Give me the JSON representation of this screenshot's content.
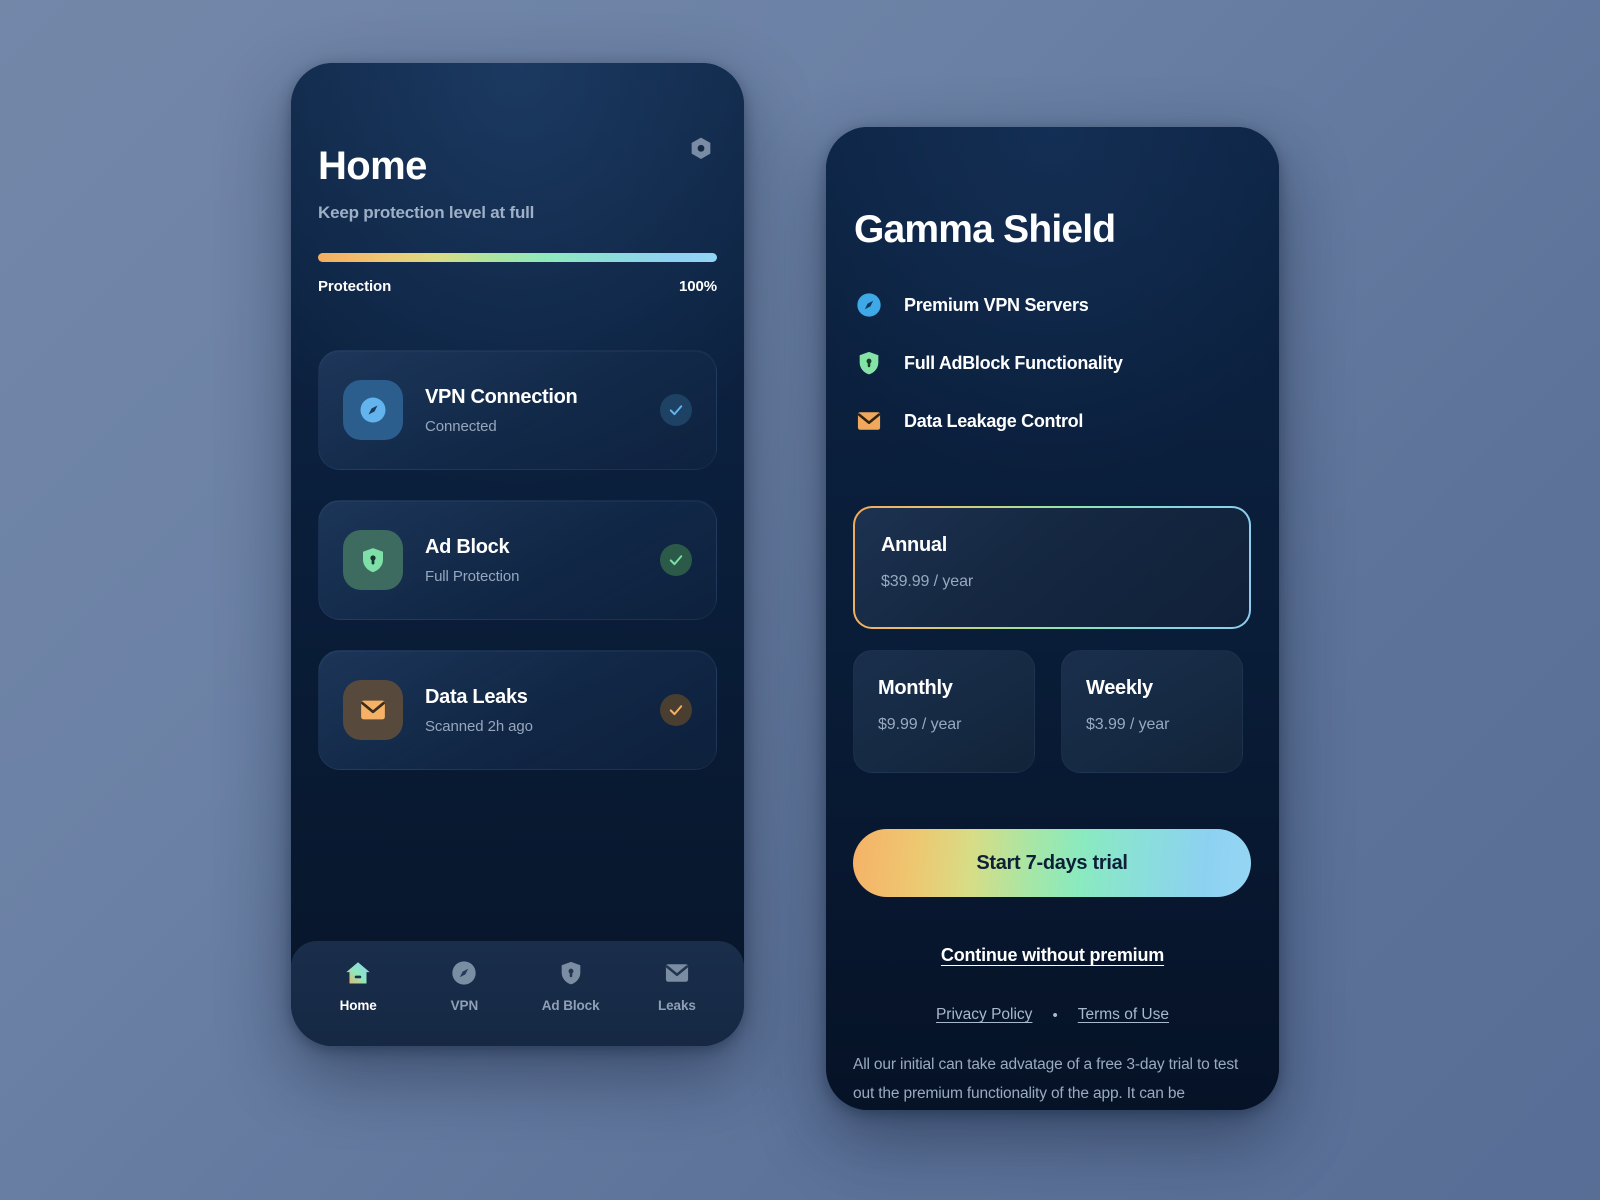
{
  "theme": {
    "background_start": "#7387a9",
    "background_end": "#526790",
    "phone_bg": "#0c2140",
    "accent_orange": "#f3ad60",
    "accent_green": "#8ee9bd",
    "accent_blue": "#8ed2f0"
  },
  "home_screen": {
    "settings_icon": "hex-nut-settings-icon",
    "title": "Home",
    "subtitle": "Keep protection level at full",
    "progress": {
      "label": "Protection",
      "value_label": "100%",
      "percent": 100
    },
    "cards": [
      {
        "icon": "compass-icon",
        "title": "VPN Connection",
        "status": "Connected",
        "check": "check-icon",
        "accent": "#63b3ed"
      },
      {
        "icon": "shield-lock-icon",
        "title": "Ad Block",
        "status": "Full Protection",
        "check": "check-icon",
        "accent": "#7ee0a8"
      },
      {
        "icon": "envelope-icon",
        "title": "Data Leaks",
        "status": "Scanned 2h ago",
        "check": "check-icon",
        "accent": "#f5b266"
      }
    ],
    "tabs": [
      {
        "icon": "home-icon",
        "label": "Home",
        "active": true
      },
      {
        "icon": "compass-icon",
        "label": "VPN",
        "active": false
      },
      {
        "icon": "shield-lock-icon",
        "label": "Ad Block",
        "active": false
      },
      {
        "icon": "envelope-icon",
        "label": "Leaks",
        "active": false
      }
    ]
  },
  "paywall_screen": {
    "title": "Gamma Shield",
    "benefits": [
      {
        "icon": "compass-icon",
        "label": "Premium VPN Servers"
      },
      {
        "icon": "shield-lock-icon",
        "label": "Full AdBlock Functionality"
      },
      {
        "icon": "envelope-icon",
        "label": "Data Leakage Control"
      }
    ],
    "plans": {
      "featured": {
        "name": "Annual",
        "price": "$39.99 / year",
        "selected": true
      },
      "others": [
        {
          "name": "Monthly",
          "price": "$9.99 / year",
          "selected": false
        },
        {
          "name": "Weekly",
          "price": "$3.99 / year",
          "selected": false
        }
      ]
    },
    "cta_label": "Start 7-days trial",
    "secondary_label": "Continue without premium",
    "legal": {
      "privacy": "Privacy Policy",
      "separator": "•",
      "terms": "Terms of Use"
    },
    "disclaimer": "All our initial can take advatage of a free 3-day trial to test out the premium functionality of the app. It can be"
  }
}
